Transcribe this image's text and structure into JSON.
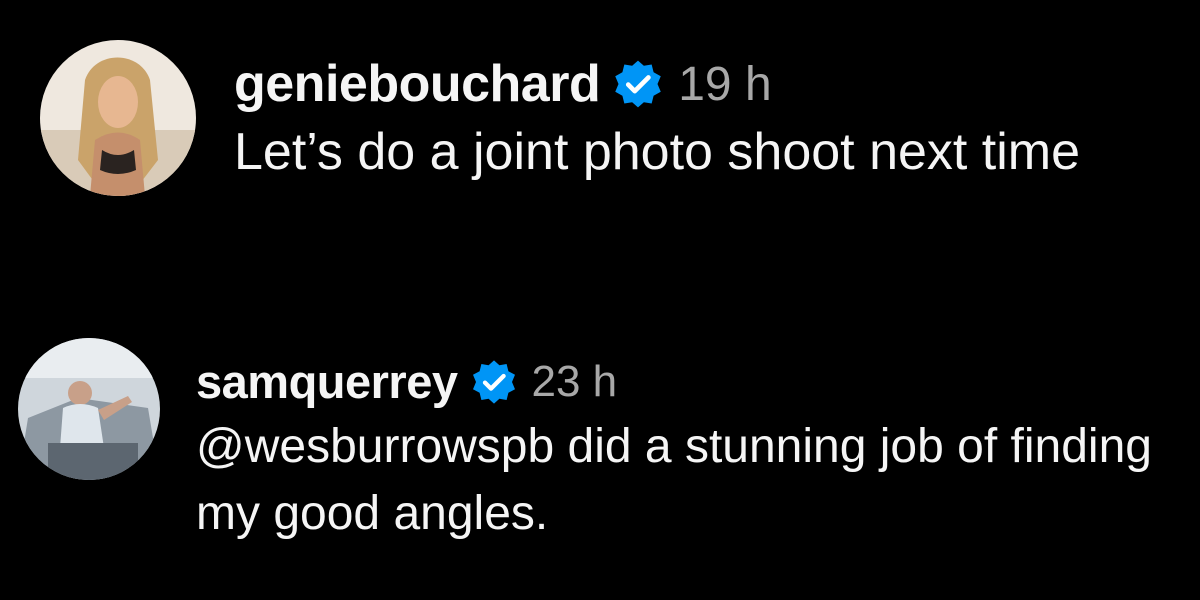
{
  "colors": {
    "background": "#000000",
    "text": "#f5f5f5",
    "muted": "#a8a8a8",
    "verified": "#0095f6"
  },
  "comments": [
    {
      "username": "geniebouchard",
      "verified_icon": "verified-badge-icon",
      "time": "19 h",
      "text": "Let’s do a joint photo shoot next time"
    },
    {
      "username": "samquerrey",
      "verified_icon": "verified-badge-icon",
      "time": "23 h",
      "text": "@wesburrowspb did a stunning job of finding my good angles."
    }
  ]
}
